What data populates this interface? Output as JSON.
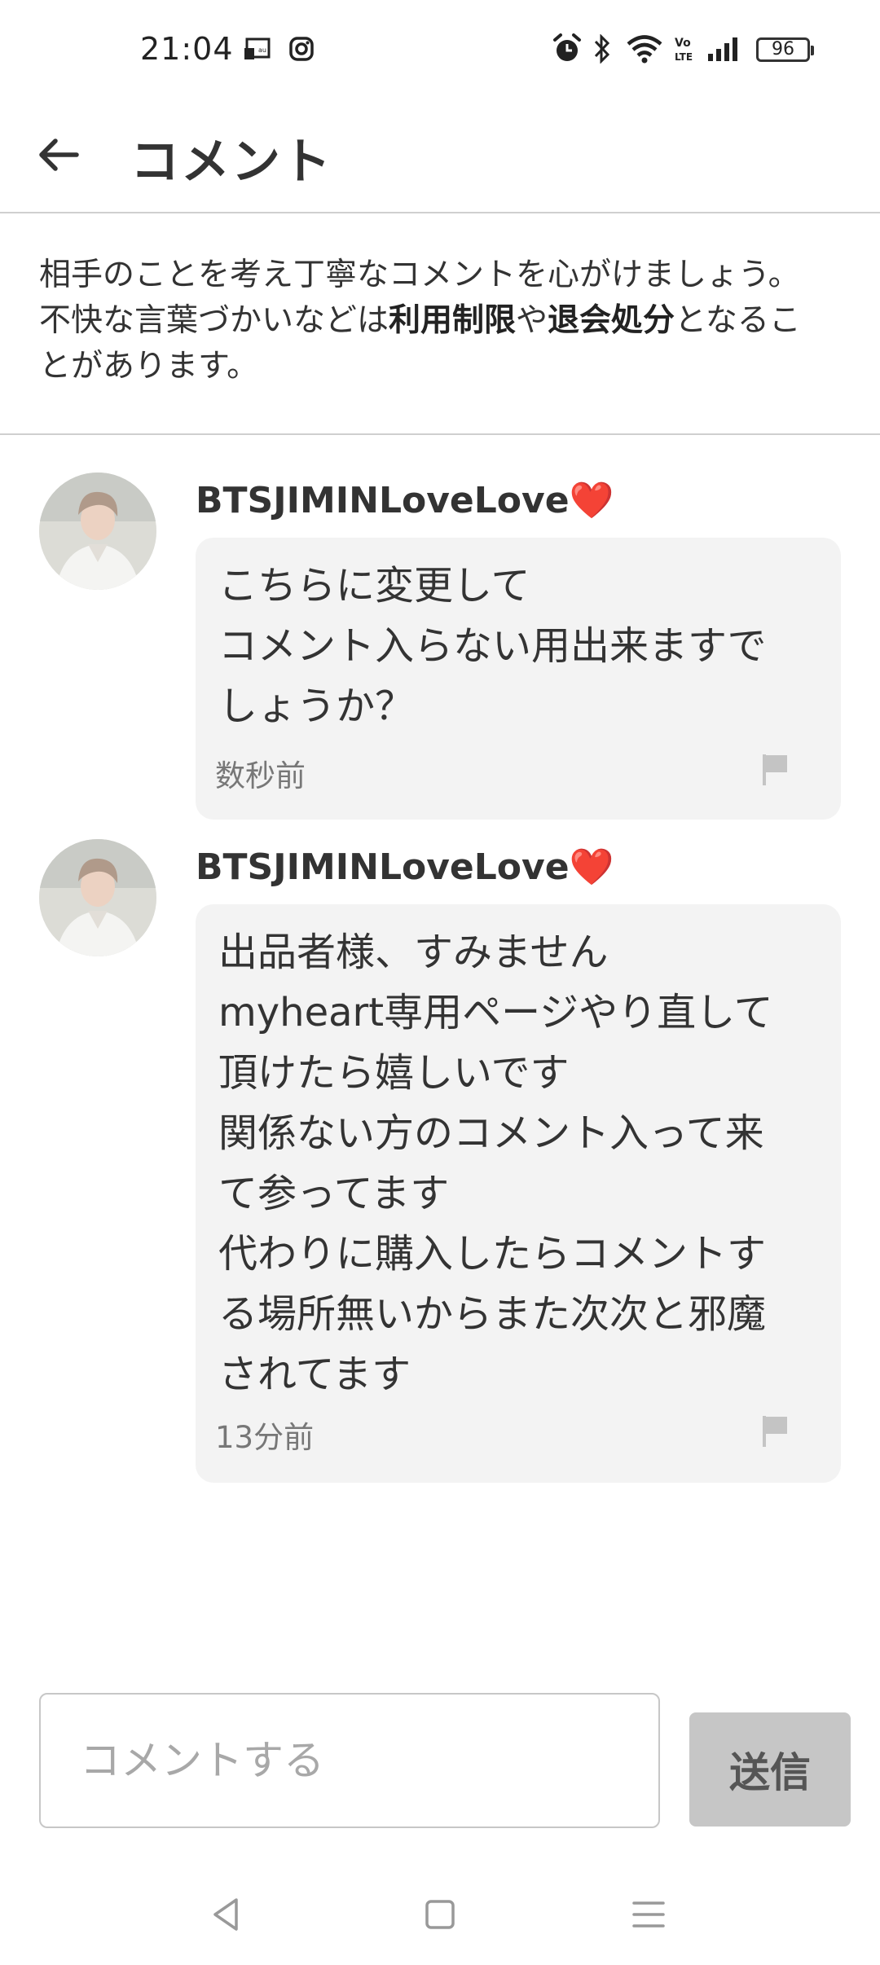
{
  "status_bar": {
    "time": "21:04",
    "battery": "96",
    "battery_level": 0.96,
    "icons": [
      "cast-icon",
      "instagram-icon",
      "alarm-icon",
      "bluetooth-icon",
      "wifi-icon",
      "volte-icon",
      "signal-icon"
    ]
  },
  "header": {
    "title": "コメント",
    "back_icon": "arrow-left-icon"
  },
  "notice": {
    "line1": "相手のことを考え丁寧なコメントを心がけましょう。",
    "line2_a": "不快な言葉づかいなどは",
    "line2_b": "利用制限",
    "line2_c": "や",
    "line2_d": "退会処分",
    "line2_e": "となるこ",
    "line3": "とがあります。"
  },
  "comments": [
    {
      "username": "BTSJIMINLoveLove❤️",
      "text": "こちらに変更して\nコメント入らない用出来ますで\nしょうか？",
      "time": "数秒前"
    },
    {
      "username": "BTSJIMINLoveLove❤️",
      "text": "出品者様、すみません\nmyheart専用ページやり直して\n頂けたら嬉しいです\n関係ない方のコメント入って来\nて参ってます\n代わりに購入したらコメントす\nる場所無いからまた次次と邪魔\nされてます",
      "time": "13分前"
    }
  ],
  "composer": {
    "placeholder": "コメントする",
    "send_label": "送信"
  },
  "colors": {
    "bubble": "#f3f3f3",
    "send_button_disabled": "#c6c6c6",
    "divider": "#cfcfcf",
    "heart": "#e0202a"
  }
}
